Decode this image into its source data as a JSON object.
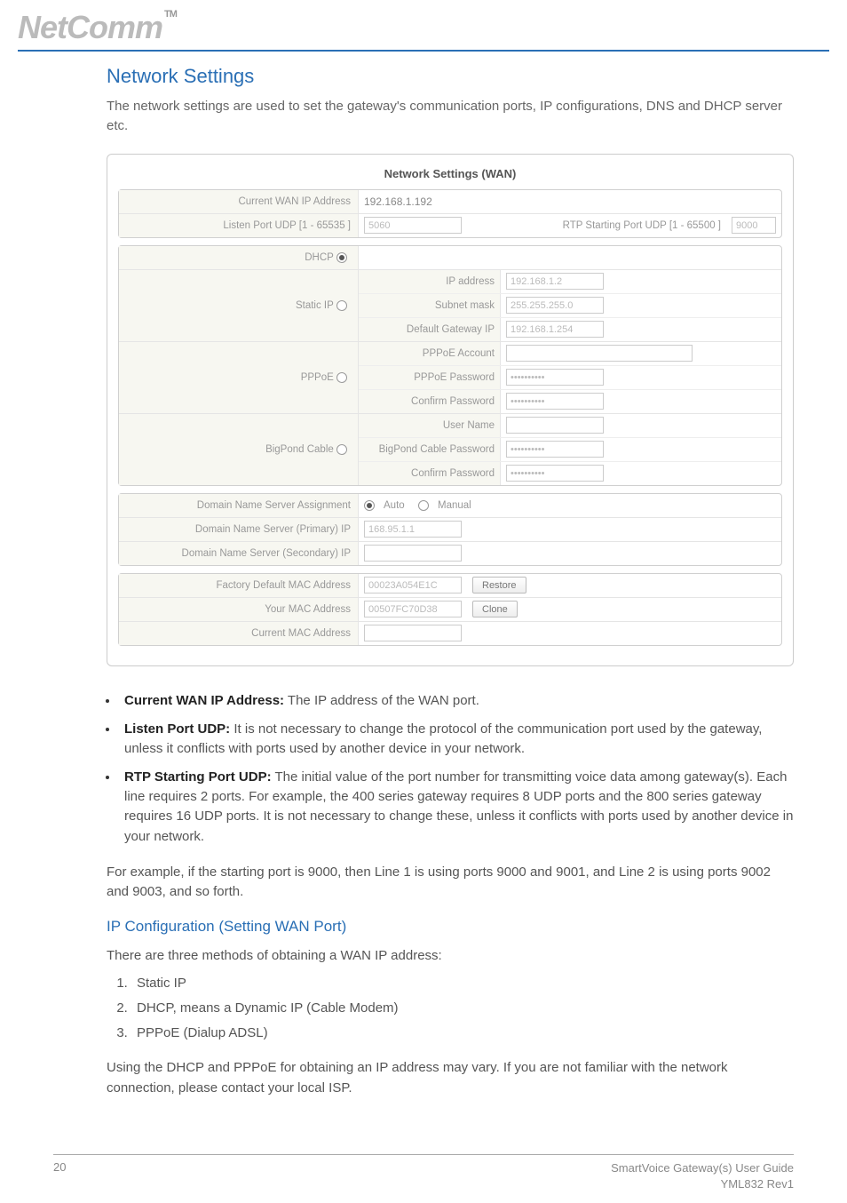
{
  "logo": {
    "text": "NetComm",
    "tm": "TM"
  },
  "section_title": "Network Settings",
  "intro": "The network settings are used to set the gateway's communication ports, IP configurations, DNS and DHCP server etc.",
  "box": {
    "title": "Network Settings (WAN)",
    "top": {
      "current_wan_label": "Current WAN IP Address",
      "current_wan_value": "192.168.1.192",
      "listen_port_label": "Listen Port UDP [1 - 65535 ]",
      "listen_port_value": "5060",
      "rtp_label": "RTP Starting Port UDP [1 - 65500 ]",
      "rtp_value": "9000"
    },
    "ip": {
      "dhcp_label": "DHCP",
      "static_label": "Static IP",
      "static": {
        "ip_label": "IP address",
        "ip_value": "192.168.1.2",
        "mask_label": "Subnet mask",
        "mask_value": "255.255.255.0",
        "gw_label": "Default Gateway IP",
        "gw_value": "192.168.1.254"
      },
      "pppoe_label": "PPPoE",
      "pppoe": {
        "acct_label": "PPPoE Account",
        "acct_value": "",
        "pw_label": "PPPoE Password",
        "pw_value": "••••••••••",
        "cpw_label": "Confirm Password",
        "cpw_value": "••••••••••"
      },
      "bigpond_label": "BigPond Cable",
      "bigpond": {
        "user_label": "User Name",
        "user_value": "",
        "bppw_label": "BigPond Cable Password",
        "bppw_value": "••••••••••",
        "bpcpw_label": "Confirm Password",
        "bpcpw_value": "••••••••••"
      }
    },
    "dns": {
      "assign_label": "Domain Name Server Assignment",
      "auto_label": "Auto",
      "manual_label": "Manual",
      "primary_label": "Domain Name Server (Primary) IP",
      "primary_value": "168.95.1.1",
      "secondary_label": "Domain Name Server (Secondary) IP",
      "secondary_value": ""
    },
    "mac": {
      "factory_label": "Factory Default MAC Address",
      "factory_value": "00023A054E1C",
      "restore_btn": "Restore",
      "your_label": "Your MAC Address",
      "your_value": "00507FC70D38",
      "clone_btn": "Clone",
      "current_label": "Current MAC Address",
      "current_value": ""
    }
  },
  "bullets": [
    {
      "bold": "Current WAN IP Address:",
      "text": " The IP address of the WAN port."
    },
    {
      "bold": "Listen Port UDP:",
      "text": " It is not necessary to change the protocol of the communication port used by the gateway, unless it conflicts with ports used by another device in your network."
    },
    {
      "bold": "RTP Starting Port UDP:",
      "text": " The initial value of the port number for transmitting voice data among gateway(s). Each line requires 2 ports. For example, the 400 series gateway requires 8 UDP ports and the 800 series gateway requires 16 UDP ports. It is not necessary to change these, unless it conflicts with ports used by another device in your network."
    }
  ],
  "example": "For example, if the starting port is 9000, then Line 1 is using ports 9000 and 9001, and Line 2 is using ports 9002 and 9003, and so forth.",
  "ipconfig_title": "IP Configuration (Setting WAN Port)",
  "methods_intro": "There are three methods of obtaining a WAN IP address:",
  "methods": [
    "Static IP",
    "DHCP, means a Dynamic IP (Cable Modem)",
    "PPPoE (Dialup ADSL)"
  ],
  "tail": "Using the DHCP and PPPoE for obtaining an IP address may vary. If you are not familiar with the network connection, please contact your local ISP.",
  "footer": {
    "page": "20",
    "guide": "SmartVoice Gateway(s) User Guide",
    "rev": "YML832 Rev1"
  }
}
